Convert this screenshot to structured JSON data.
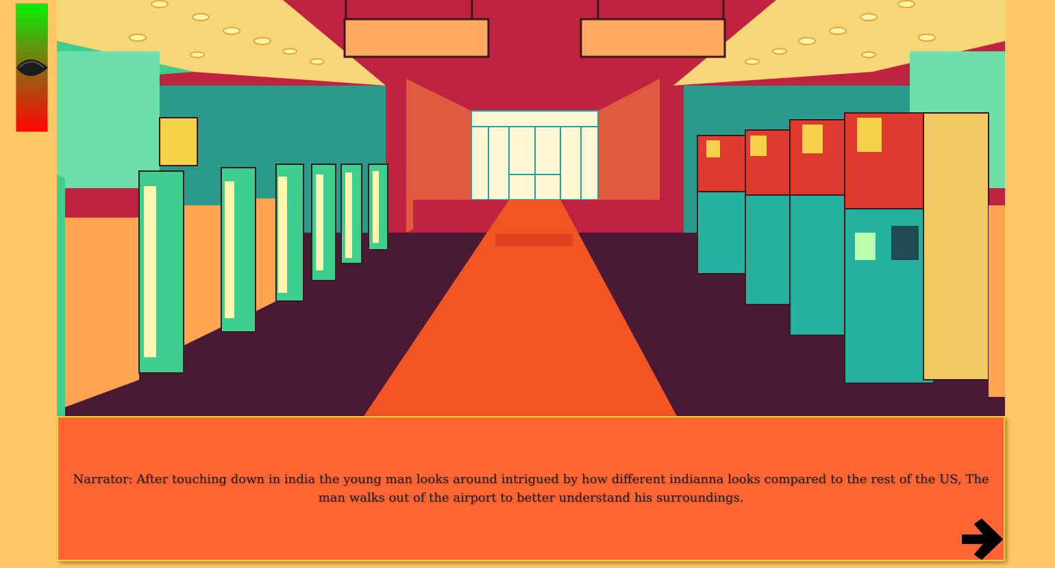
{
  "hud": {
    "meter_level": 0.5,
    "meter_colors": {
      "top": "#06f106",
      "bottom": "#ff0505"
    }
  },
  "scene": {
    "background": "airport-terminal-interior"
  },
  "dialogue": {
    "text": "Narrator: After touching down in india the young man looks around intrigued by how different indianna looks compared to the rest of the US, The man walks out of the airport to better understand his surroundings."
  },
  "controls": {
    "next_icon": "arrow-right-icon"
  },
  "colors": {
    "page_background": "#ffc766",
    "dialogue_background": "#ff6633",
    "dialogue_border": "#f2d533",
    "ceiling": "#c0233f",
    "floor": "#4a1a35",
    "carpet": "#f25524",
    "counter_glow": "#9ff5a0",
    "kiosk": "#e03a2e"
  }
}
